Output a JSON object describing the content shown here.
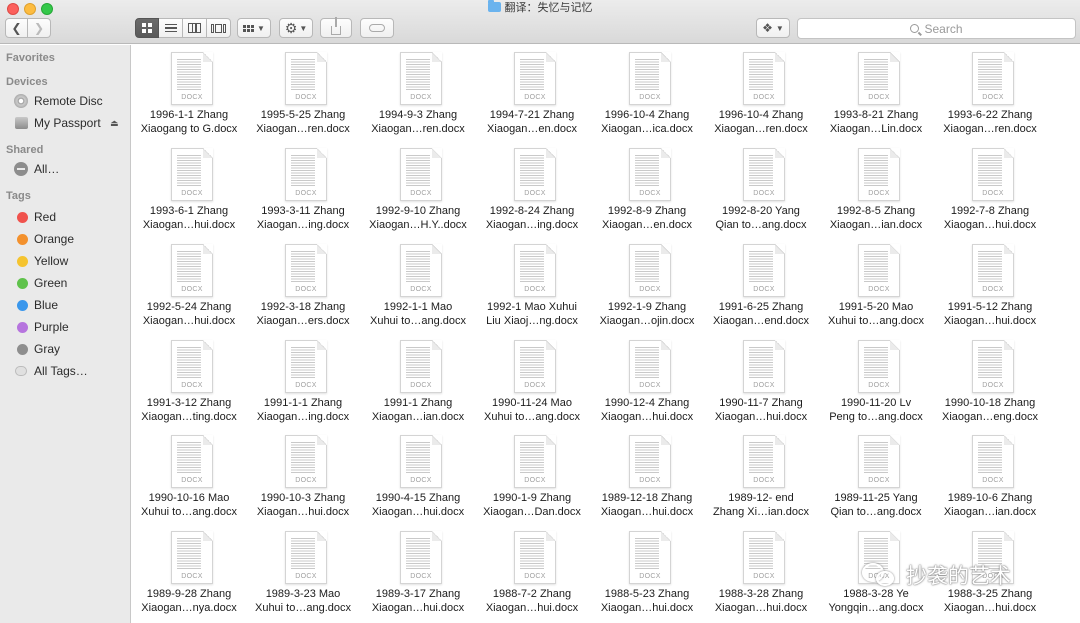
{
  "window": {
    "title": "翻译：失忆与记忆"
  },
  "toolbar": {
    "back_icon": "chevron-left-icon",
    "forward_icon": "chevron-right-icon",
    "search_placeholder": "Search"
  },
  "sidebar": {
    "favorites_header": "Favorites",
    "devices_header": "Devices",
    "devices": [
      {
        "label": "Remote Disc",
        "icon": "disc-icon"
      },
      {
        "label": "My Passport",
        "icon": "hard-drive-icon"
      }
    ],
    "shared_header": "Shared",
    "shared": [
      {
        "label": "All…",
        "icon": "network-icon"
      }
    ],
    "tags_header": "Tags",
    "tags": [
      {
        "label": "Red",
        "color": "#f0524d"
      },
      {
        "label": "Orange",
        "color": "#f3912d"
      },
      {
        "label": "Yellow",
        "color": "#f5c42f"
      },
      {
        "label": "Green",
        "color": "#5fc24b"
      },
      {
        "label": "Blue",
        "color": "#3a97ec"
      },
      {
        "label": "Purple",
        "color": "#b674de"
      },
      {
        "label": "Gray",
        "color": "#8e8e8e"
      },
      {
        "label": "All Tags…",
        "color": ""
      }
    ]
  },
  "file_ext_badge": "DOCX",
  "files": [
    [
      "1996-1-1 Zhang",
      "Xiaogang to G.docx"
    ],
    [
      "1995-5-25 Zhang",
      "Xiaogan…ren.docx"
    ],
    [
      "1994-9-3 Zhang",
      "Xiaogan…ren.docx"
    ],
    [
      "1994-7-21 Zhang",
      "Xiaogan…en.docx"
    ],
    [
      "1996-10-4 Zhang",
      "Xiaogan…ica.docx"
    ],
    [
      "1996-10-4 Zhang",
      "Xiaogan…ren.docx"
    ],
    [
      "1993-8-21 Zhang",
      "Xiaogan…Lin.docx"
    ],
    [
      "1993-6-22 Zhang",
      "Xiaogan…ren.docx"
    ],
    [
      "1993-6-1 Zhang",
      "Xiaogan…hui.docx"
    ],
    [
      "1993-3-11 Zhang",
      "Xiaogan…ing.docx"
    ],
    [
      "1992-9-10 Zhang",
      "Xiaogan…H.Y..docx"
    ],
    [
      "1992-8-24 Zhang",
      "Xiaogan…ing.docx"
    ],
    [
      "1992-8-9 Zhang",
      "Xiaogan…en.docx"
    ],
    [
      "1992-8-20 Yang",
      "Qian to…ang.docx"
    ],
    [
      "1992-8-5 Zhang",
      "Xiaogan…ian.docx"
    ],
    [
      "1992-7-8 Zhang",
      "Xiaogan…hui.docx"
    ],
    [
      "1992-5-24 Zhang",
      "Xiaogan…hui.docx"
    ],
    [
      "1992-3-18 Zhang",
      "Xiaogan…ers.docx"
    ],
    [
      "1992-1-1 Mao",
      "Xuhui to…ang.docx"
    ],
    [
      "1992-1 Mao Xuhui",
      "Liu Xiaoj…ng.docx"
    ],
    [
      "1992-1-9 Zhang",
      "Xiaogan…ojin.docx"
    ],
    [
      "1991-6-25 Zhang",
      "Xiaogan…end.docx"
    ],
    [
      "1991-5-20 Mao",
      "Xuhui to…ang.docx"
    ],
    [
      "1991-5-12 Zhang",
      "Xiaogan…hui.docx"
    ],
    [
      "1991-3-12 Zhang",
      "Xiaogan…ting.docx"
    ],
    [
      "1991-1-1 Zhang",
      "Xiaogan…ing.docx"
    ],
    [
      "1991-1 Zhang",
      "Xiaogan…ian.docx"
    ],
    [
      "1990-11-24 Mao",
      "Xuhui to…ang.docx"
    ],
    [
      "1990-12-4 Zhang",
      "Xiaogan…hui.docx"
    ],
    [
      "1990-11-7 Zhang",
      "Xiaogan…hui.docx"
    ],
    [
      "1990-11-20 Lv",
      "Peng to…ang.docx"
    ],
    [
      "1990-10-18 Zhang",
      "Xiaogan…eng.docx"
    ],
    [
      "1990-10-16 Mao",
      "Xuhui to…ang.docx"
    ],
    [
      "1990-10-3 Zhang",
      "Xiaogan…hui.docx"
    ],
    [
      "1990-4-15 Zhang",
      "Xiaogan…hui.docx"
    ],
    [
      "1990-1-9 Zhang",
      "Xiaogan…Dan.docx"
    ],
    [
      "1989-12-18 Zhang",
      "Xiaogan…hui.docx"
    ],
    [
      "1989-12- end",
      "Zhang Xi…ian.docx"
    ],
    [
      "1989-11-25 Yang",
      "Qian to…ang.docx"
    ],
    [
      "1989-10-6 Zhang",
      "Xiaogan…ian.docx"
    ],
    [
      "1989-9-28 Zhang",
      "Xiaogan…nya.docx"
    ],
    [
      "1989-3-23 Mao",
      "Xuhui to…ang.docx"
    ],
    [
      "1989-3-17 Zhang",
      "Xiaogan…hui.docx"
    ],
    [
      "1988-7-2 Zhang",
      "Xiaogan…hui.docx"
    ],
    [
      "1988-5-23 Zhang",
      "Xiaogan…hui.docx"
    ],
    [
      "1988-3-28 Zhang",
      "Xiaogan…hui.docx"
    ],
    [
      "1988-3-28 Ye",
      "Yongqin…ang.docx"
    ],
    [
      "1988-3-25 Zhang",
      "Xiaogan…hui.docx"
    ]
  ],
  "watermark": {
    "text": "抄袭的艺术"
  }
}
